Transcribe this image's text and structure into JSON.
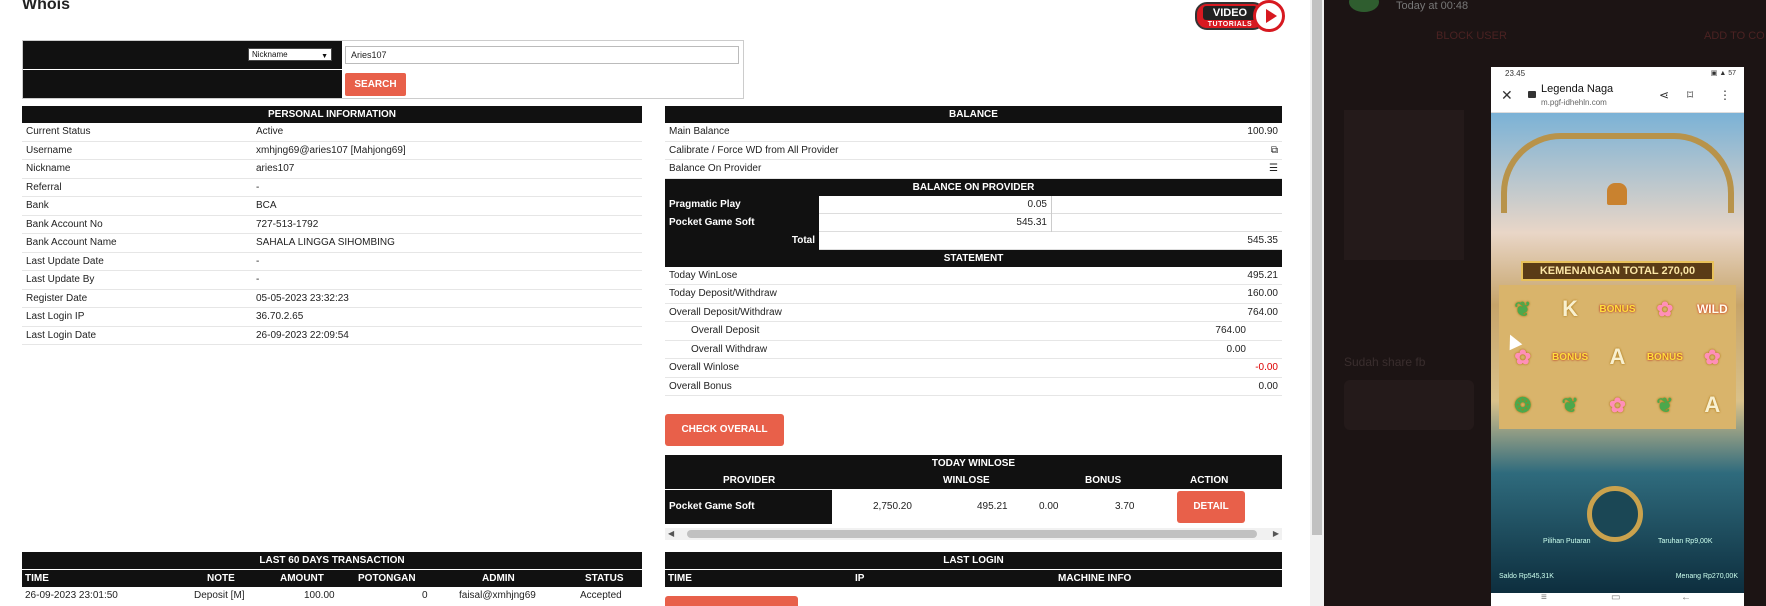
{
  "page_title": "Whois",
  "video_tutorials": {
    "line1": "VIDEO",
    "line2": "TUTORIALS"
  },
  "search": {
    "type_selected": "Nickname",
    "value": "Aries107",
    "button": "SEARCH"
  },
  "personal": {
    "header": "PERSONAL INFORMATION",
    "rows": [
      {
        "label": "Current Status",
        "value": "Active"
      },
      {
        "label": "Username",
        "value": "xmhjng69@aries107  [Mahjong69]"
      },
      {
        "label": "Nickname",
        "value": "aries107"
      },
      {
        "label": "Referral",
        "value": "-"
      },
      {
        "label": "Bank",
        "value": "BCA"
      },
      {
        "label": "Bank Account No",
        "value": "727-513-1792"
      },
      {
        "label": "Bank Account Name",
        "value": "SAHALA LINGGA SIHOMBING"
      },
      {
        "label": "Last Update Date",
        "value": "-"
      },
      {
        "label": "Last Update By",
        "value": "-"
      },
      {
        "label": "Register Date",
        "value": "05-05-2023 23:32:23"
      },
      {
        "label": "Last Login IP",
        "value": "36.70.2.65"
      },
      {
        "label": "Last Login Date",
        "value": "26-09-2023 22:09:54"
      }
    ]
  },
  "balance": {
    "header": "BALANCE",
    "main_label": "Main Balance",
    "main_value": "100.90",
    "calibrate_label": "Calibrate / Force WD from All Provider",
    "on_provider_label": "Balance On Provider",
    "provider_header": "BALANCE ON PROVIDER",
    "providers": [
      {
        "name": "Pragmatic Play",
        "value": "0.05"
      },
      {
        "name": "Pocket Game Soft",
        "value": "545.31"
      }
    ],
    "total_label": "Total",
    "total_value": "545.35"
  },
  "statement": {
    "header": "STATEMENT",
    "today_winlose_label": "Today WinLose",
    "today_winlose": "495.21",
    "today_dw_label": "Today Deposit/Withdraw",
    "today_dw": "160.00",
    "overall_dw_label": "Overall Deposit/Withdraw",
    "overall_dw": "764.00",
    "overall_deposit_label": "Overall Deposit",
    "overall_deposit": "764.00",
    "overall_withdraw_label": "Overall Withdraw",
    "overall_withdraw": "0.00",
    "overall_winlose_label": "Overall Winlose",
    "overall_winlose": "-0.00",
    "overall_bonus_label": "Overall Bonus",
    "overall_bonus": "0.00",
    "check_button": "CHECK OVERALL"
  },
  "today_winlose": {
    "header": "TODAY WINLOSE",
    "cols": {
      "provider": "PROVIDER",
      "winlose": "WINLOSE",
      "bonus": "BONUS",
      "action": "ACTION"
    },
    "row": {
      "provider": "Pocket Game Soft",
      "turnover": "2,750.20",
      "winlose": "495.21",
      "v3": "0.00",
      "bonus": "3.70",
      "button": "DETAIL"
    }
  },
  "last60": {
    "header": "LAST 60 DAYS TRANSACTION",
    "cols": {
      "time": "TIME",
      "note": "NOTE",
      "amount": "AMOUNT",
      "potongan": "POTONGAN",
      "admin": "ADMIN",
      "status": "STATUS"
    },
    "row": {
      "time": "26-09-2023 23:01:50",
      "note": "Deposit [M]",
      "amount": "100.00",
      "potongan": "0",
      "admin": "faisal@xmhjng69",
      "status": "Accepted"
    }
  },
  "last_login": {
    "header": "LAST LOGIN",
    "cols": {
      "time": "TIME",
      "ip": "IP",
      "machine": "MACHINE INFO"
    }
  },
  "chat": {
    "time": "Today at 00:48",
    "block": "BLOCK USER",
    "add": "ADD TO CO",
    "ghost": "Sudah share fb"
  },
  "phone": {
    "clock": "23.45",
    "status_right": "▣ ▲ 57",
    "title": "Legenda Naga",
    "url": "m.pgf-idhehln.com",
    "win_text": "KEMENANGAN TOTAL 270,00",
    "label_spin": "Pilihan Putaran",
    "label_bet": "Taruhan Rp9,00K",
    "saldo": "Saldo Rp545,31K",
    "menang": "Menang Rp270,00K",
    "grid": [
      [
        "❦",
        "K",
        "BONUS",
        "✿",
        "WILD"
      ],
      [
        "✿",
        "BONUS",
        "A",
        "BONUS",
        "✿"
      ],
      [
        "❂",
        "❦",
        "✿",
        "❦",
        "A"
      ]
    ]
  },
  "colors": {
    "accent": "#e8604a",
    "header_bg": "#111111",
    "negative": "#dd0000"
  }
}
